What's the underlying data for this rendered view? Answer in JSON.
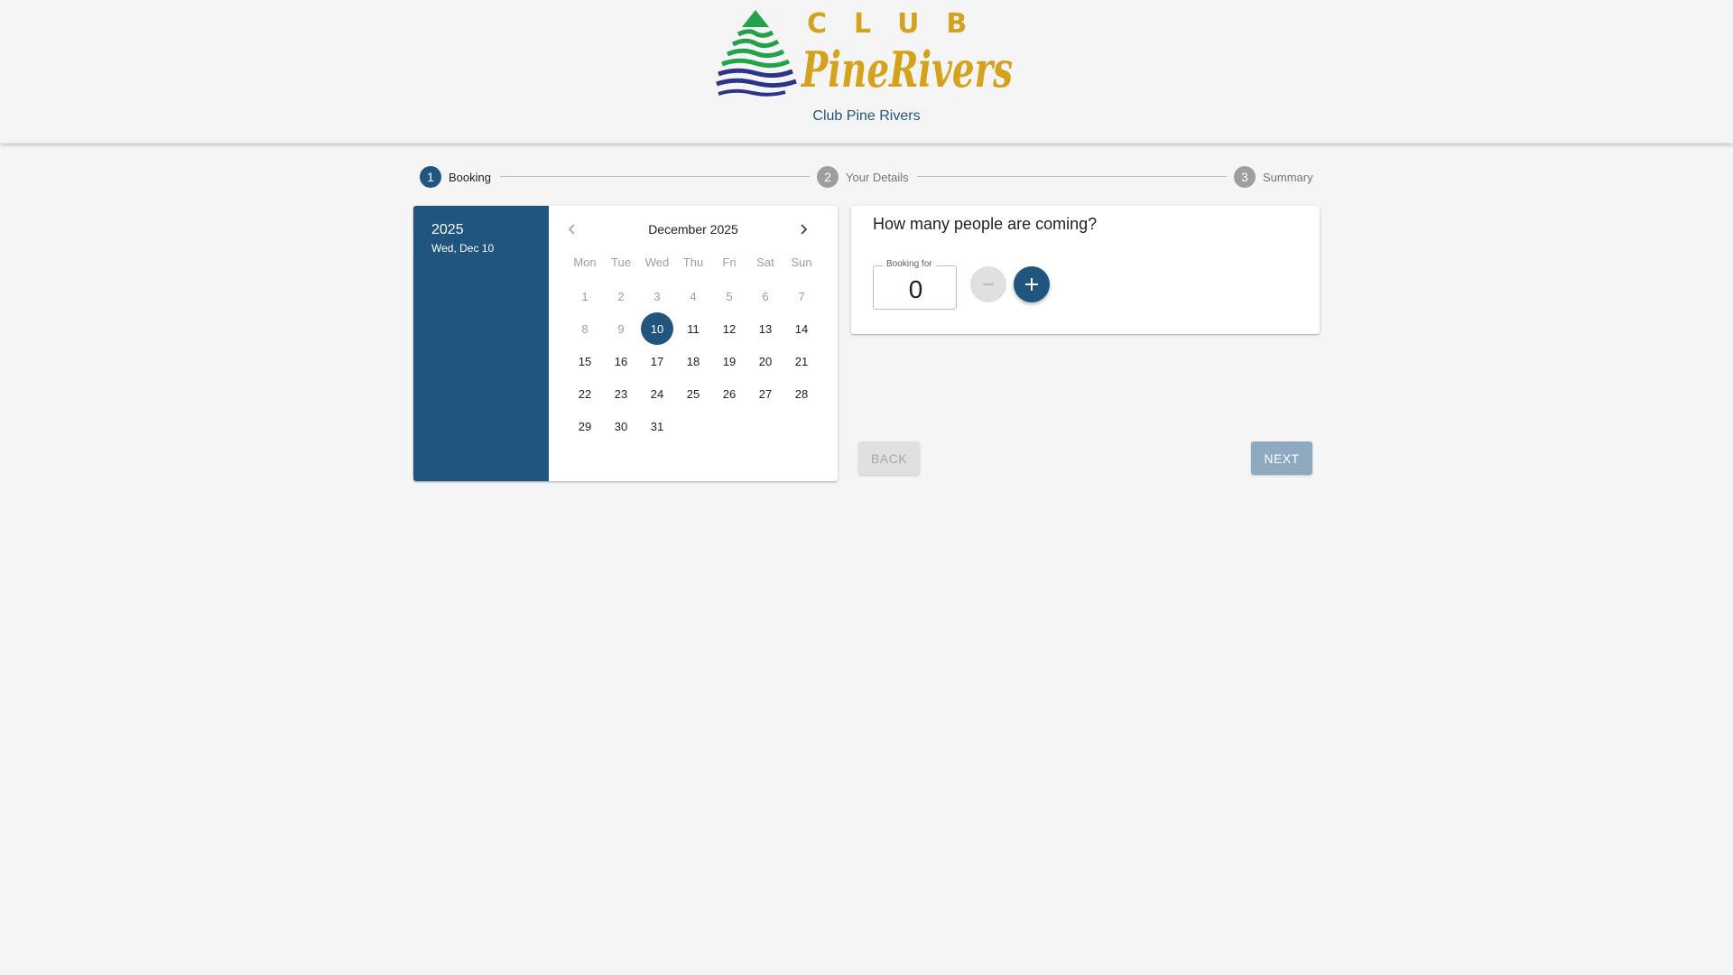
{
  "header": {
    "club_name": "Club Pine Rivers"
  },
  "logo": {
    "text_club": "CLUB",
    "text_name": "PineRivers",
    "colors": {
      "gold": "#d4a21c",
      "green": "#22a24a",
      "navy": "#2a3589"
    }
  },
  "stepper": {
    "steps": [
      {
        "number": "1",
        "label": "Booking",
        "active": true
      },
      {
        "number": "2",
        "label": "Your Details",
        "active": false
      },
      {
        "number": "3",
        "label": "Summary",
        "active": false
      }
    ]
  },
  "datepicker": {
    "year": "2025",
    "selected_date_label": "Wed, Dec 10",
    "month_label": "December 2025",
    "prev_icon": "chevron-left-icon",
    "next_icon": "chevron-right-icon",
    "weekdays": [
      "Mon",
      "Tue",
      "Wed",
      "Thu",
      "Fri",
      "Sat",
      "Sun"
    ],
    "weeks": [
      [
        "1",
        "2",
        "3",
        "4",
        "5",
        "6",
        "7"
      ],
      [
        "8",
        "9",
        "10",
        "11",
        "12",
        "13",
        "14"
      ],
      [
        "15",
        "16",
        "17",
        "18",
        "19",
        "20",
        "21"
      ],
      [
        "22",
        "23",
        "24",
        "25",
        "26",
        "27",
        "28"
      ],
      [
        "29",
        "30",
        "31"
      ]
    ],
    "disabled_days": [
      "1",
      "2",
      "3",
      "4",
      "5",
      "6",
      "7",
      "8",
      "9"
    ],
    "selected_day": "10"
  },
  "booking": {
    "question": "How many people are coming?",
    "field_label": "Booking for",
    "count": "0",
    "minus_icon": "minus-icon",
    "plus_icon": "plus-icon"
  },
  "actions": {
    "back_label": "Back",
    "next_label": "Next"
  },
  "colors": {
    "primary": "#205580",
    "background": "#f5f5f5",
    "disabled": "#9e9e9e"
  }
}
